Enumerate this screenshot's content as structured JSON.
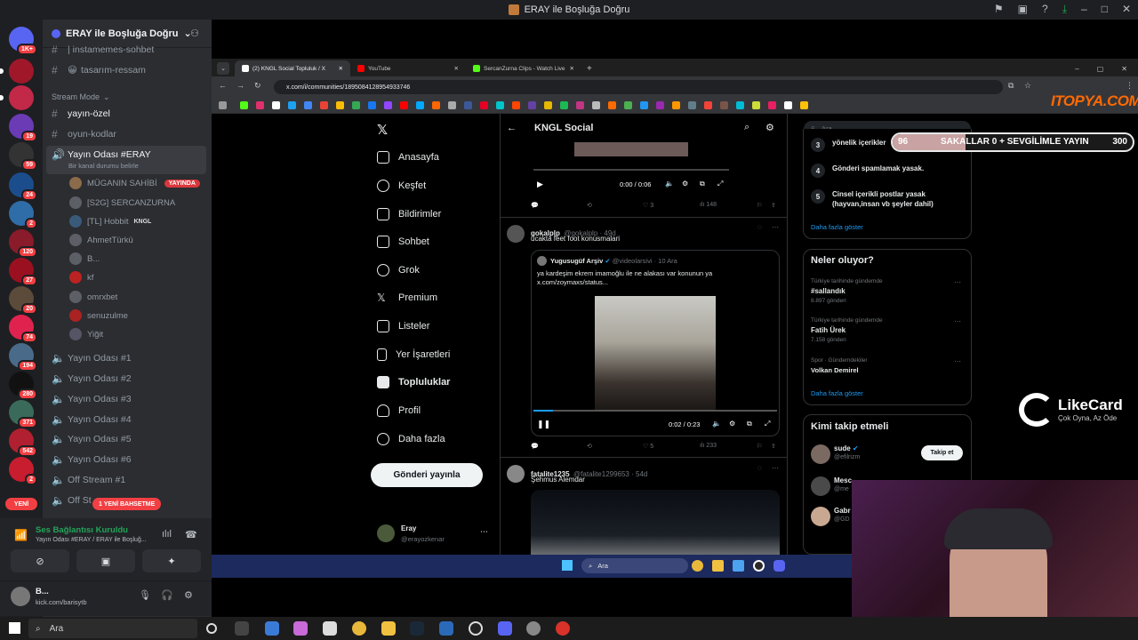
{
  "window": {
    "title": "ERAY ile Boşluğa Doğru"
  },
  "server": {
    "name": "ERAY ile Boşluğa Doğru"
  },
  "rail_badges": [
    "1K+",
    "19",
    "59",
    "24",
    "2",
    "120",
    "27",
    "20",
    "74",
    "194",
    "280",
    "371",
    "542",
    "2"
  ],
  "channels_top": [
    "| instamemes-sohbet",
    "tasarım-ressam"
  ],
  "category": "Stream Mode",
  "channels_mid": [
    "yayın-özel",
    "oyun-kodlar"
  ],
  "voice_active": {
    "name": "Yayın Odası #ERAY",
    "status": "Bir kanal durumu belirle"
  },
  "voice_users": [
    {
      "name": "MÜGANIN SAHİBİ",
      "live": "YAYINDA"
    },
    {
      "name": "[S2G] SERCANZURNA"
    },
    {
      "name": "[TL] Hobbit",
      "tag": "KNGL"
    },
    {
      "name": "AhmetTürkü"
    },
    {
      "name": "B..."
    },
    {
      "name": "kf"
    },
    {
      "name": "omrxbet"
    },
    {
      "name": "senuzulme"
    },
    {
      "name": "Yiğit"
    }
  ],
  "voice_rooms": [
    "Yayın Odası #1",
    "Yayın Odası #2",
    "Yayın Odası #3",
    "Yayın Odası #4",
    "Yayın Odası #5",
    "Yayın Odası #6",
    "Off Stream #1",
    "Off St"
  ],
  "new_badge": "YENİ",
  "mention_badge": "1 YENİ BAHSETME",
  "voice_panel": {
    "status": "Ses Bağlantısı Kuruldu",
    "detail": "Yayın Odası #ERAY / ERAY ile Boşluğ..."
  },
  "user_panel": {
    "name": "B...",
    "status": "kick.com/barisytb"
  },
  "browser": {
    "tabs": [
      {
        "label": "(2) KNGL Social Topluluk / X",
        "color": "#000000"
      },
      {
        "label": "YouTube",
        "color": "#ff0000"
      },
      {
        "label": "SercanZurna Clips - Watch Live",
        "color": "#53fc18"
      }
    ],
    "url": "x.com/i/communities/1895084128954933746"
  },
  "x_nav": [
    "Anasayfa",
    "Keşfet",
    "Bildirimler",
    "Sohbet",
    "Grok",
    "Premium",
    "Listeler",
    "Yer İşaretleri",
    "Topluluklar",
    "Profil",
    "Daha fazla"
  ],
  "x_post_button": "Gönderi yayınla",
  "x_account": {
    "name": "Eray",
    "handle": "@erayozkenar"
  },
  "feed": {
    "title": "KNGL Social",
    "video1": {
      "time": "0:00 / 0:06",
      "replies": "",
      "likes": "3",
      "views": "148"
    },
    "tweet1": {
      "name": "gokalplp",
      "handle": "@gokalplp · 49d",
      "text": "ucakta feet foot konusmalari",
      "quote": {
        "name": "Yugusugüf Arşiv",
        "handle": "@videolarsivi · 10 Ara",
        "text": "ya kardeşim ekrem imamoğlu ile ne alakası var konunun ya x.com/zoymaxs/status..."
      },
      "video_time": "0:02 / 0:23",
      "likes": "5",
      "views": "233"
    },
    "tweet2": {
      "name": "fatalite1235",
      "handle": "@fatalite1299653 · 54d",
      "text": "Şehmus Alemdar"
    }
  },
  "rules": [
    {
      "num": "3",
      "text": "yönelik içerikler"
    },
    {
      "num": "4",
      "text": "Gönderi spamlamak yasak."
    },
    {
      "num": "5",
      "text": "Cinsel içerikli postlar yasak (hayvan,insan vb şeyler dahil)"
    }
  ],
  "show_more": "Daha fazla göster",
  "trends": {
    "title": "Neler oluyor?",
    "items": [
      {
        "meta": "Türkiye tarihinde gündemde",
        "name": "#sallandık",
        "count": "8.897 gönderi"
      },
      {
        "meta": "Türkiye tarihinde gündemde",
        "name": "Fatih Ürek",
        "count": "7.158 gönderi"
      },
      {
        "meta": "Spor · Gündemdekiler",
        "name": "Volkan Demirel",
        "count": ""
      }
    ]
  },
  "who_to_follow": {
    "title": "Kimi takip etmeli",
    "users": [
      {
        "name": "sude",
        "handle": "@efilrizm",
        "button": "Takip et"
      },
      {
        "name": "Mesc",
        "handle": "@me"
      },
      {
        "name": "Gabr",
        "handle": "@GD"
      }
    ]
  },
  "search_placeholder": "Ara",
  "overlay": {
    "donation_left": "96",
    "donation_text": "SAKALLAR 0 + SEVGİLİMLE YAYIN",
    "donation_right": "300",
    "logo_brand": "LikeCard",
    "logo_tagline": "Çok Oyna, Az Öde",
    "watermark": "ITOPYA.COM"
  },
  "taskbar": {
    "search": "Ara"
  },
  "inner_taskbar": {
    "search": "Ara"
  }
}
